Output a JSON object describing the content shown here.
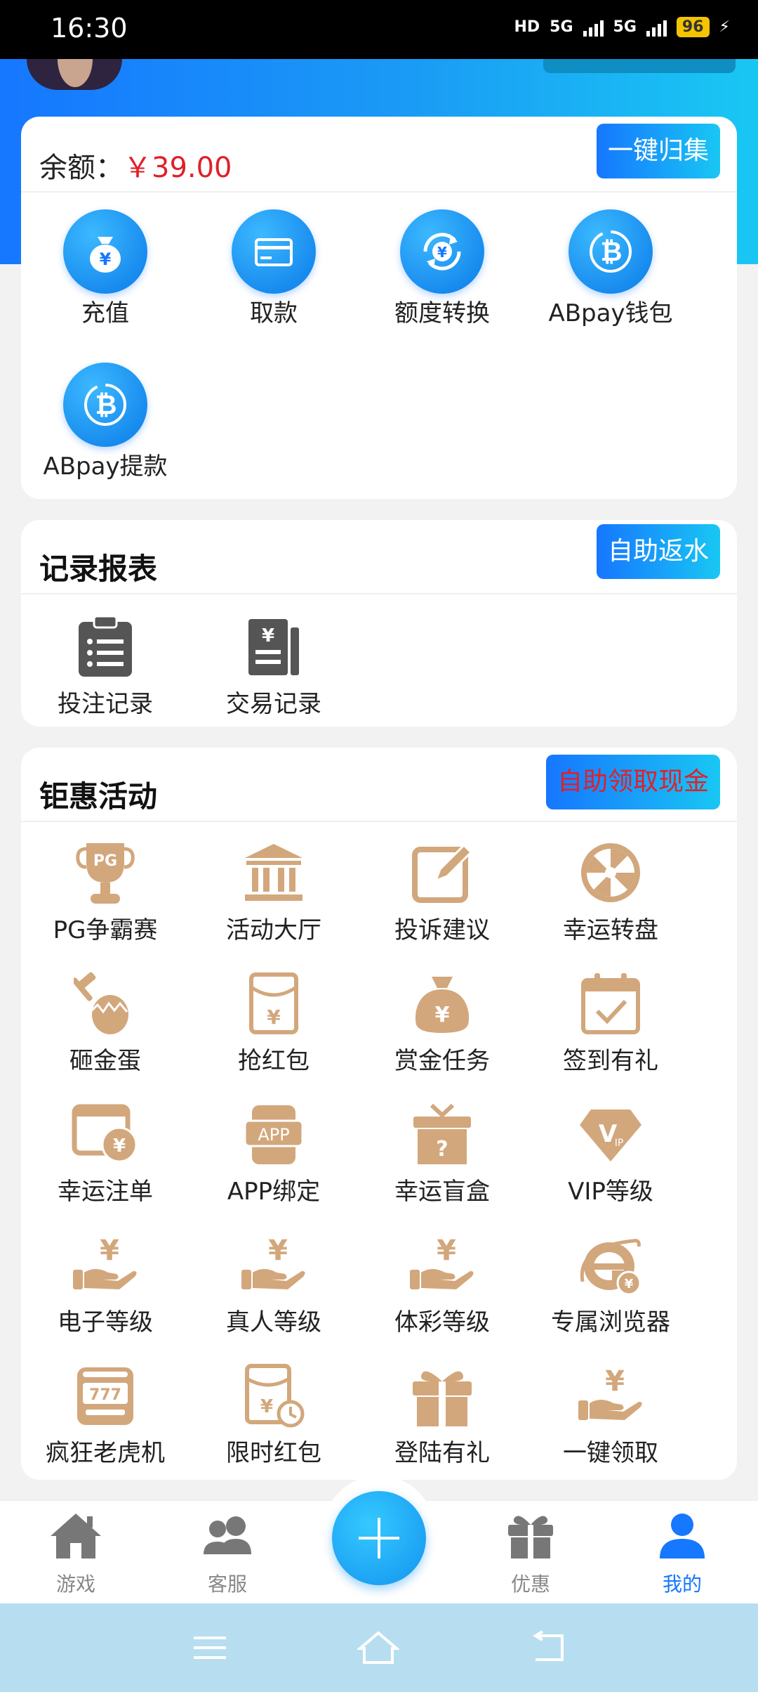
{
  "status_bar": {
    "time": "16:30",
    "network1": "5G",
    "network2": "5G",
    "hd": "HD",
    "battery": "96"
  },
  "wallet": {
    "balance_label": "余额：",
    "balance_value": "￥39.00",
    "collect_button": "一键归集",
    "actions": [
      {
        "label": "充值",
        "icon": "money-bag-icon"
      },
      {
        "label": "取款",
        "icon": "card-icon"
      },
      {
        "label": "额度转换",
        "icon": "exchange-icon"
      },
      {
        "label": "ABpay钱包",
        "icon": "bitcoin-icon"
      },
      {
        "label": "ABpay提款",
        "icon": "bitcoin-icon"
      }
    ]
  },
  "records": {
    "title": "记录报表",
    "rebate_button": "自助返水",
    "items": [
      {
        "label": "投注记录",
        "icon": "clipboard-list-icon"
      },
      {
        "label": "交易记录",
        "icon": "receipt-icon"
      }
    ]
  },
  "promotions": {
    "title": "钜惠活动",
    "claim_button": "自助领取现金",
    "items": [
      {
        "label": "PG争霸赛",
        "icon": "trophy-icon"
      },
      {
        "label": "活动大厅",
        "icon": "hall-icon"
      },
      {
        "label": "投诉建议",
        "icon": "edit-icon"
      },
      {
        "label": "幸运转盘",
        "icon": "wheel-icon"
      },
      {
        "label": "砸金蛋",
        "icon": "golden-egg-icon"
      },
      {
        "label": "抢红包",
        "icon": "red-envelope-icon"
      },
      {
        "label": "赏金任务",
        "icon": "money-bag-icon"
      },
      {
        "label": "签到有礼",
        "icon": "calendar-check-icon"
      },
      {
        "label": "幸运注单",
        "icon": "wallet-yen-icon"
      },
      {
        "label": "APP绑定",
        "icon": "app-icon"
      },
      {
        "label": "幸运盲盒",
        "icon": "mystery-box-icon"
      },
      {
        "label": "VIP等级",
        "icon": "vip-diamond-icon"
      },
      {
        "label": "电子等级",
        "icon": "hand-yen-icon"
      },
      {
        "label": "真人等级",
        "icon": "hand-yen-icon"
      },
      {
        "label": "体彩等级",
        "icon": "hand-yen-icon"
      },
      {
        "label": "专属浏览器",
        "icon": "browser-icon"
      },
      {
        "label": "疯狂老虎机",
        "icon": "slot-machine-icon"
      },
      {
        "label": "限时红包",
        "icon": "timed-envelope-icon"
      },
      {
        "label": "登陆有礼",
        "icon": "gift-icon"
      },
      {
        "label": "一键领取",
        "icon": "hand-yen-icon"
      }
    ]
  },
  "tabs": [
    {
      "label": "游戏",
      "icon": "home-icon"
    },
    {
      "label": "客服",
      "icon": "users-icon"
    },
    {
      "label": "优惠",
      "icon": "gift-icon"
    },
    {
      "label": "我的",
      "icon": "user-icon",
      "active": true
    }
  ],
  "colors": {
    "accent": "#1677ff",
    "accent_light": "#19c7f3",
    "price_red": "#e0202a",
    "promo_tan": "#d2a77c",
    "dark_icon": "#555555"
  }
}
